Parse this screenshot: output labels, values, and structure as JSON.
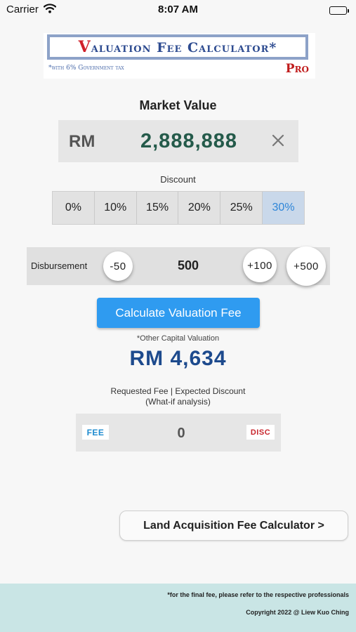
{
  "status_bar": {
    "carrier": "Carrier",
    "time": "8:07 AM"
  },
  "logo": {
    "title_first": "V",
    "title_rest": "aluation Fee Calculator*",
    "tax_note": "*with 6% Government tax",
    "pro": "Pro"
  },
  "market_value": {
    "title": "Market Value",
    "currency": "RM",
    "value": "2,888,888"
  },
  "discount": {
    "title": "Discount",
    "options": [
      "0%",
      "10%",
      "15%",
      "20%",
      "25%",
      "30%"
    ],
    "selected": "30%"
  },
  "disbursement": {
    "label": "Disbursement",
    "minus_label": "-50",
    "value": "500",
    "plus100_label": "+100",
    "plus500_label": "+500"
  },
  "calculate_button": "Calculate Valuation Fee",
  "result": {
    "note": "*Other Capital Valuation",
    "value": "RM 4,634"
  },
  "requested": {
    "title_line1": "Requested Fee | Expected Discount",
    "title_line2": "(What-if analysis)",
    "fee_tag": "FEE",
    "value": "0",
    "disc_tag": "DISC"
  },
  "land_button": "Land Acquisition Fee Calculator >",
  "footer": {
    "note": "*for the final fee, please refer to the respective professionals",
    "copyright": "Copyright 2022 @ Liew Kuo Ching"
  },
  "colors": {
    "accent": "#2f9bf0",
    "result": "#1d4a8d",
    "market_value": "#245a4a",
    "footer_bg": "#c9e5e5",
    "disc_active": "#2f86d8"
  },
  "icons": [
    "wifi-icon",
    "battery-icon",
    "clear-icon"
  ]
}
